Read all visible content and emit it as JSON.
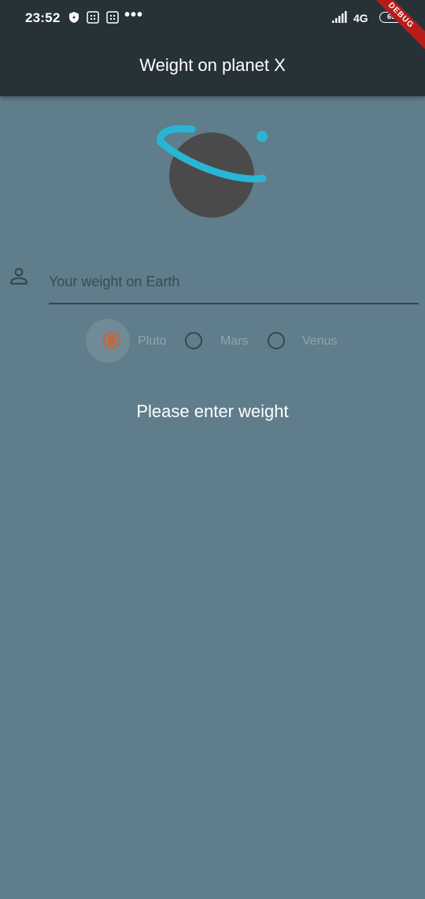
{
  "status_bar": {
    "time": "23:52",
    "dots": "•••",
    "network": "4G",
    "battery": "69"
  },
  "app_bar": {
    "title": "Weight on planet X",
    "debug_banner": "DEBUG"
  },
  "form": {
    "input_placeholder": "Your weight on Earth",
    "input_value": "",
    "planets": [
      {
        "label": "Pluto",
        "selected": true
      },
      {
        "label": "Mars",
        "selected": false
      },
      {
        "label": "Venus",
        "selected": false
      }
    ]
  },
  "result": {
    "text": "Please enter weight"
  },
  "icons": {
    "status": [
      "shield-icon",
      "sim-icon",
      "sim-icon",
      "more-dots-icon",
      "signal-icon",
      "battery-icon"
    ],
    "input": "person-icon",
    "logo": "planet-logo-icon"
  },
  "colors": {
    "background": "#607d8b",
    "app_bar": "#263238",
    "accent": "#d4622a",
    "planet_ring": "#29b6d6",
    "planet_body": "#4a4a4a",
    "debug_banner": "#b71c1c"
  }
}
